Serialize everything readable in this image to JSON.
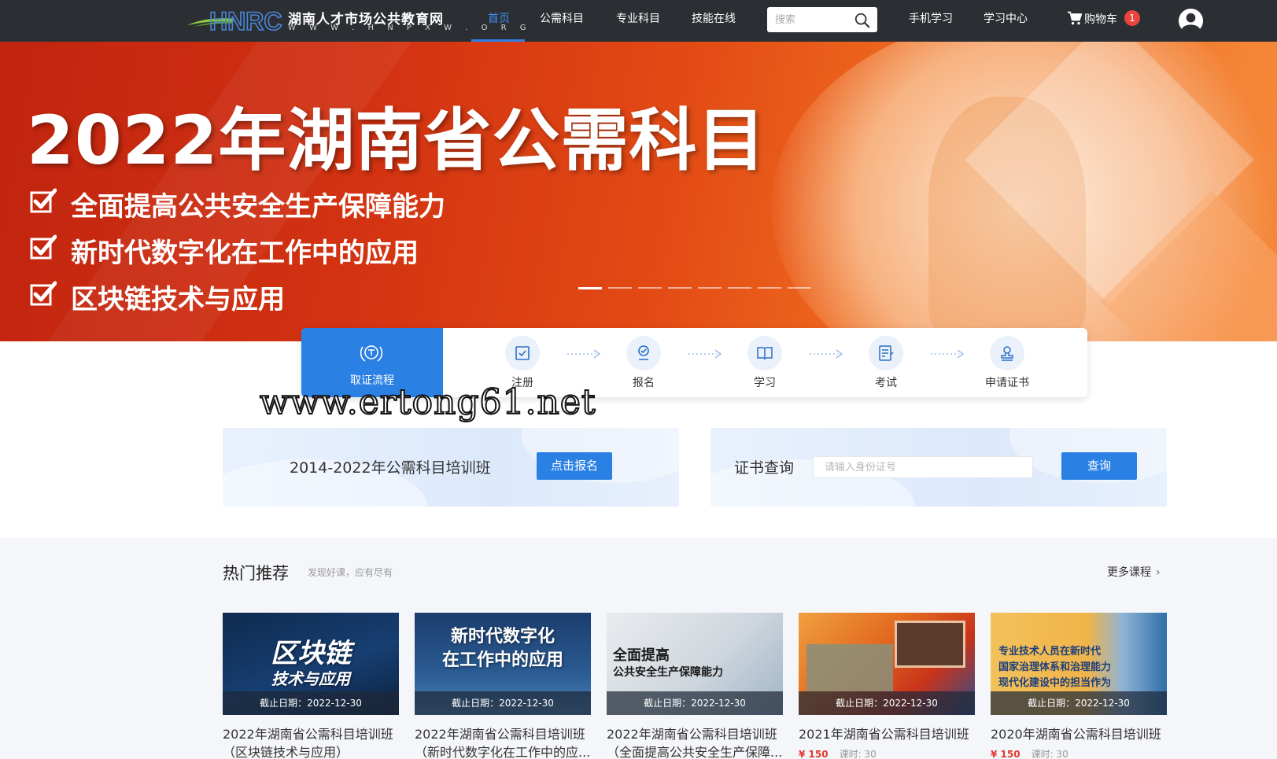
{
  "header": {
    "logo_mark": "HNRC",
    "site_name": "湖南人才市场公共教育网",
    "site_domain": "W W W . H N P X W . O R G",
    "nav": [
      {
        "label": "首页",
        "active": true
      },
      {
        "label": "公需科目",
        "active": false
      },
      {
        "label": "专业科目",
        "active": false
      },
      {
        "label": "技能在线",
        "active": false
      }
    ],
    "search_placeholder": "搜索",
    "mobile_label": "手机学习",
    "study_center_label": "学习中心",
    "cart_label": "购物车",
    "cart_count": "1",
    "icons": {
      "search": "search-icon",
      "cart": "cart-icon",
      "user": "user-avatar-icon"
    }
  },
  "banner": {
    "title": "2022年湖南省公需科目",
    "points": [
      "全面提高公共安全生产保障能力",
      "新时代数字化在工作中的应用",
      "区块链技术与应用"
    ],
    "slide_count": 8,
    "active_slide": 1
  },
  "process": {
    "title": "取证流程",
    "steps": [
      "注册",
      "报名",
      "学习",
      "考试",
      "申请证书"
    ]
  },
  "watermark": "www.ertong61.net",
  "enroll_card": {
    "text": "2014-2022年公需科目培训班",
    "button": "点击报名"
  },
  "cert_card": {
    "label": "证书查询",
    "placeholder": "请输入身份证号",
    "button": "查询"
  },
  "hot": {
    "title": "热门推荐",
    "subtitle": "发现好课，应有尽有",
    "more": "更多课程",
    "courses": [
      {
        "thumb_line1": "区块链",
        "thumb_line2": "技术与应用",
        "deadline": "截止日期：2022-12-30",
        "name": "2022年湖南省公需科目培训班",
        "sub": "（区块链技术与应用）",
        "price": "",
        "hours": ""
      },
      {
        "thumb_line1": "新时代数字化",
        "thumb_line2": "在工作中的应用",
        "deadline": "截止日期：2022-12-30",
        "name": "2022年湖南省公需科目培训班",
        "sub": "（新时代数字化在工作中的应...",
        "price": "",
        "hours": ""
      },
      {
        "thumb_line1": "全面提高",
        "thumb_line2": "公共安全生产保障能力",
        "deadline": "截止日期：2022-12-30",
        "name": "2022年湖南省公需科目培训班",
        "sub": "（全面提高公共安全生产保障...",
        "price": "",
        "hours": ""
      },
      {
        "thumb_line1": "",
        "thumb_line2": "",
        "deadline": "截止日期：2022-12-30",
        "name": "2021年湖南省公需科目培训班",
        "sub": "",
        "price": "¥ 150",
        "hours": "课时: 30"
      },
      {
        "thumb_line1": "专业技术人员在新时代",
        "thumb_line2": "国家治理体系和治理能力",
        "thumb_line3": "现代化建设中的担当作为",
        "deadline": "截止日期：2022-12-30",
        "name": "2020年湖南省公需科目培训班",
        "sub": "",
        "price": "¥ 150",
        "hours": "课时: 30"
      }
    ]
  },
  "colors": {
    "nav_bg": "#2b2e33",
    "accent": "#2b80e3",
    "banner_red": "#d33312",
    "price": "#e23a2e"
  }
}
